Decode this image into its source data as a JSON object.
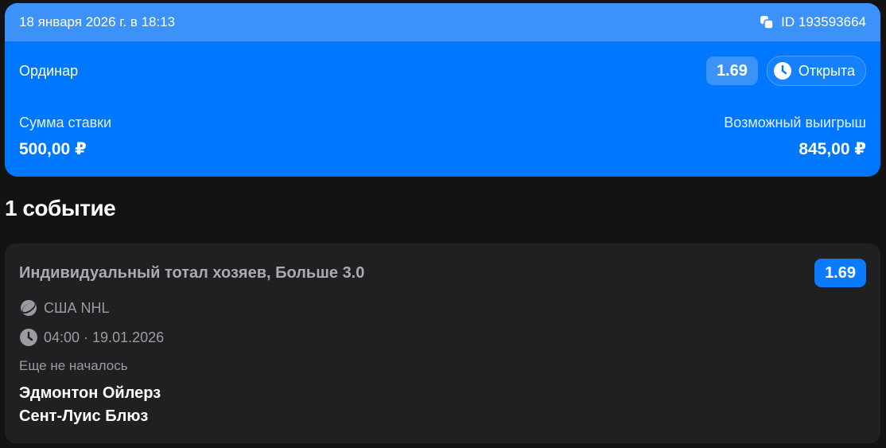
{
  "bet": {
    "datetime": "18 января 2026 г. в 18:13",
    "id_label": "ID 193593664",
    "type": "Ординар",
    "odds": "1.69",
    "status": "Открыта",
    "stake_label": "Сумма ставки",
    "stake_value": "500,00 ₽",
    "win_label": "Возможный выигрыш",
    "win_value": "845,00 ₽",
    "colors": {
      "accent": "#0077ff",
      "header": "#3c92f8"
    }
  },
  "events_title": "1 событие",
  "event": {
    "market": "Индивидуальный тотал хозяев, Больше 3.0",
    "odds": "1.69",
    "league": "США NHL",
    "time": "04:00 · 19.01.2026",
    "status": "Еще не началось",
    "team_home": "Эдмонтон Ойлерз",
    "team_away": "Сент-Луис Блюз",
    "icons": {
      "sport": "hockey-puck-icon",
      "time": "clock-icon"
    }
  }
}
